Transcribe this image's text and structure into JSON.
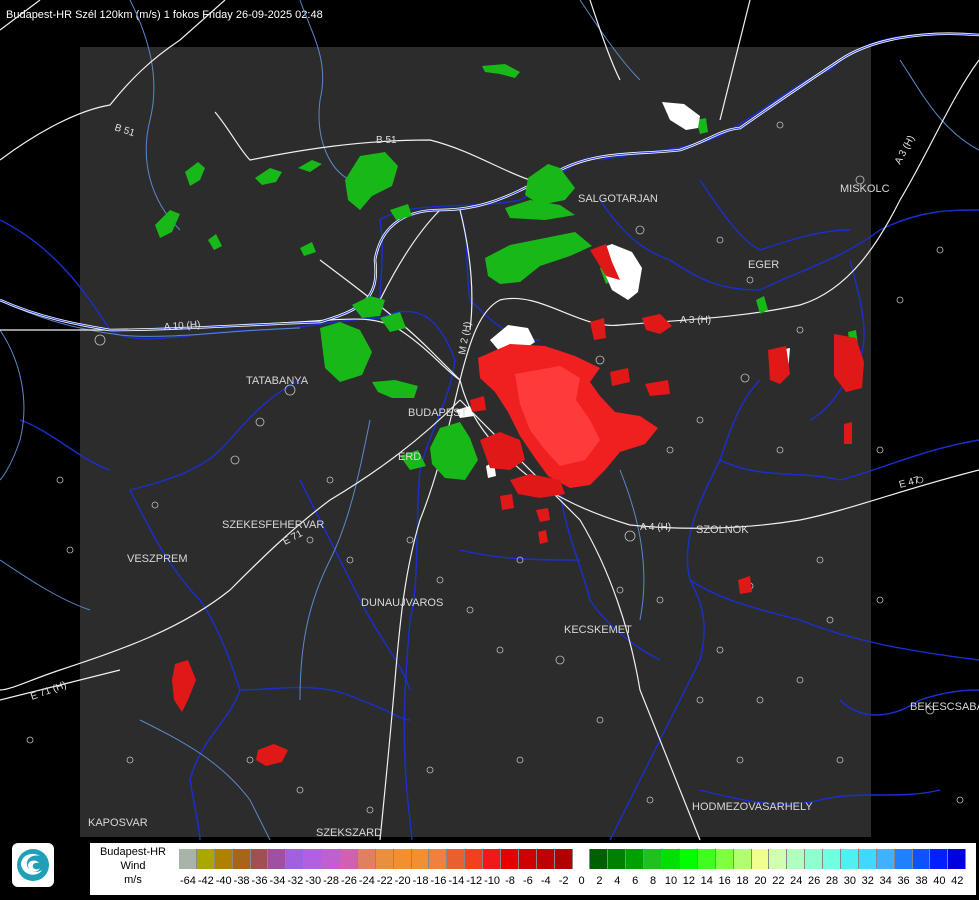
{
  "title": "Budapest-HR Szél 120km (m/s) 1 fokos Friday 26-09-2025 02:48",
  "cities": [
    "SALGOTARJAN",
    "MISKOLC",
    "EGER",
    "TATABANYA",
    "BUDAPEST",
    "ERD",
    "SZEKESFEHERVAR",
    "VESZPREM",
    "DUNAUJVAROS",
    "KECSKEMET",
    "SZOLNOK",
    "BEKESCSABA",
    "HODMEZOVASARHELY",
    "KAPOSVAR",
    "SZEKSZARD"
  ],
  "roads": [
    "B 51",
    "B 51",
    "A 3 (H)",
    "A 3 (H)",
    "A 10 (H)",
    "M 2 (H)",
    "E 71",
    "A 4 (H)",
    "E 47",
    "E 71 (H)"
  ],
  "legend": {
    "name": [
      "Budapest-HR",
      "Wind",
      "m/s"
    ],
    "values": [
      "-64",
      "-42",
      "-40",
      "-38",
      "-36",
      "-34",
      "-32",
      "-30",
      "-28",
      "-26",
      "-24",
      "-22",
      "-20",
      "-18",
      "-16",
      "-14",
      "-12",
      "-10",
      "-8",
      "-6",
      "-4",
      "-2",
      "0",
      "2",
      "4",
      "6",
      "8",
      "10",
      "12",
      "14",
      "16",
      "18",
      "20",
      "22",
      "24",
      "26",
      "28",
      "30",
      "32",
      "34",
      "36",
      "38",
      "40",
      "42"
    ],
    "colors": [
      "#a8b4a8",
      "#a8a800",
      "#b08000",
      "#a86418",
      "#a05050",
      "#a050a0",
      "#a060e0",
      "#b060e0",
      "#c060d0",
      "#d060b0",
      "#e08060",
      "#e89040",
      "#f09030",
      "#f09030",
      "#f08040",
      "#e86030",
      "#f04020",
      "#f01818",
      "#e80000",
      "#d00000",
      "#c00000",
      "#b00000",
      "#ffffff",
      "#006000",
      "#008000",
      "#00a000",
      "#20c020",
      "#00e000",
      "#00ff00",
      "#40ff20",
      "#80ff40",
      "#b0ff70",
      "#f0ff90",
      "#d0ffb0",
      "#b0ffc0",
      "#90ffd0",
      "#70ffe0",
      "#50f0f0",
      "#40d8ff",
      "#40b0ff",
      "#2080ff",
      "#1050ff",
      "#0020ff",
      "#0000e0"
    ]
  }
}
